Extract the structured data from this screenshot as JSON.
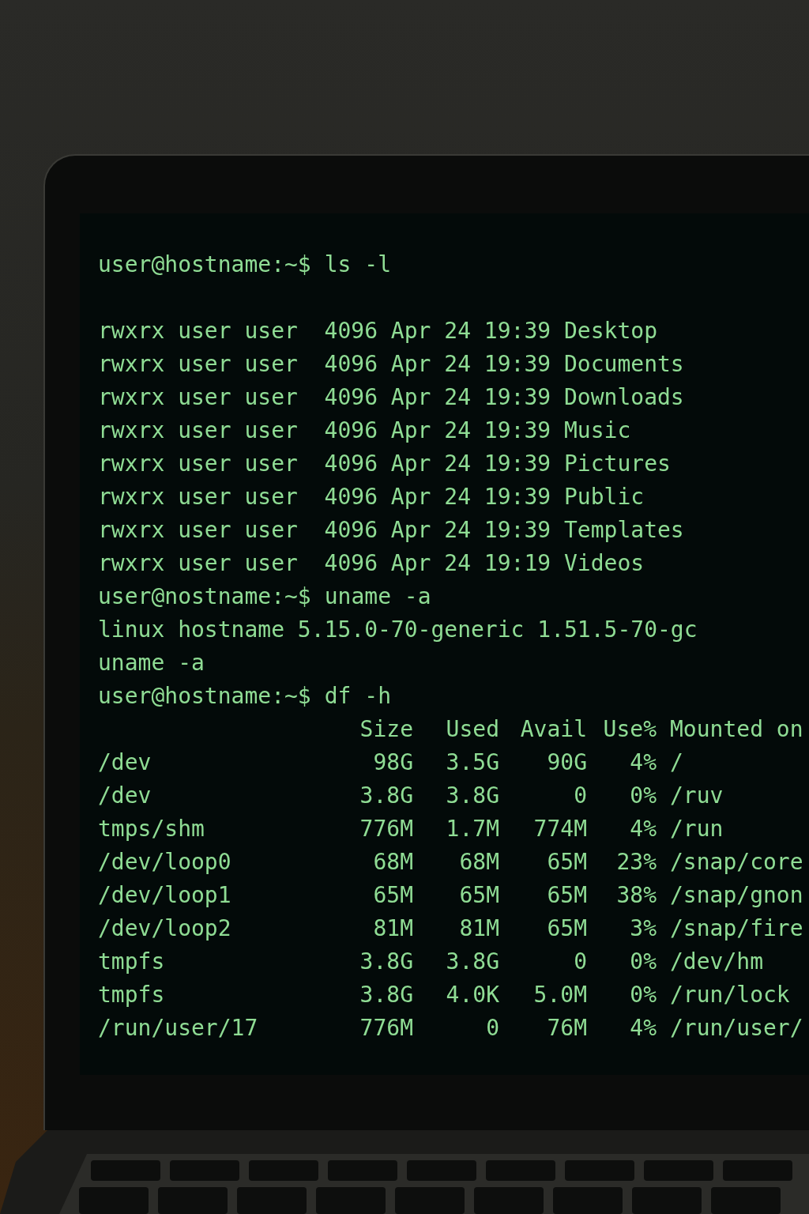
{
  "terminal": {
    "blocks": [
      {
        "kind": "command",
        "prompt": "user@hostname:~$",
        "command": "ls -l"
      },
      {
        "kind": "blank"
      },
      {
        "kind": "output",
        "lines": [
          "rwxrx user user  4096 Apr 24 19:39 Desktop",
          "rwxrx user user  4096 Apr 24 19:39 Documents",
          "rwxrx user user  4096 Apr 24 19:39 Downloads",
          "rwxrx user user  4096 Apr 24 19:39 Music",
          "rwxrx user user  4096 Apr 24 19:39 Pictures",
          "rwxrx user user  4096 Apr 24 19:39 Public",
          "rwxrx user user  4096 Apr 24 19:39 Templates",
          "rwxrx user user  4096 Apr 24 19:19 Videos"
        ]
      },
      {
        "kind": "command",
        "prompt": "user@nostname:~$",
        "command": "uname -a"
      },
      {
        "kind": "output",
        "lines": [
          "linux hostname 5.15.0-70-generic 1.51.5-70-gc",
          "uname -a"
        ]
      },
      {
        "kind": "command",
        "prompt": "user@hostname:~$",
        "command": "df -h"
      },
      {
        "kind": "table",
        "columns": [
          "",
          "Size",
          "Used",
          "Avail",
          "Use%",
          "Mounted on"
        ],
        "rows": [
          [
            "/dev",
            "98G",
            "3.5G",
            "90G",
            "4%",
            "/"
          ],
          [
            "/dev",
            "3.8G",
            "3.8G",
            "0",
            "0%",
            "/ruv"
          ],
          [
            "tmps/shm",
            "776M",
            "1.7M",
            "774M",
            "4%",
            "/run"
          ],
          [
            "/dev/loop0",
            "68M",
            "68M",
            "65M",
            "23%",
            "/snap/core"
          ],
          [
            "/dev/loop1",
            "65M",
            "65M",
            "65M",
            "38%",
            "/snap/gnon"
          ],
          [
            "/dev/loop2",
            "81M",
            "81M",
            "65M",
            "3%",
            "/snap/fire"
          ],
          [
            "tmpfs",
            "3.8G",
            "3.8G",
            "0",
            "0%",
            "/dev/hm"
          ],
          [
            "tmpfs",
            "3.8G",
            "4.0K",
            "5.0M",
            "0%",
            "/run/lock"
          ],
          [
            "/run/user/17",
            "776M",
            "0",
            "76M",
            "4%",
            "/run/user/"
          ]
        ]
      }
    ]
  }
}
